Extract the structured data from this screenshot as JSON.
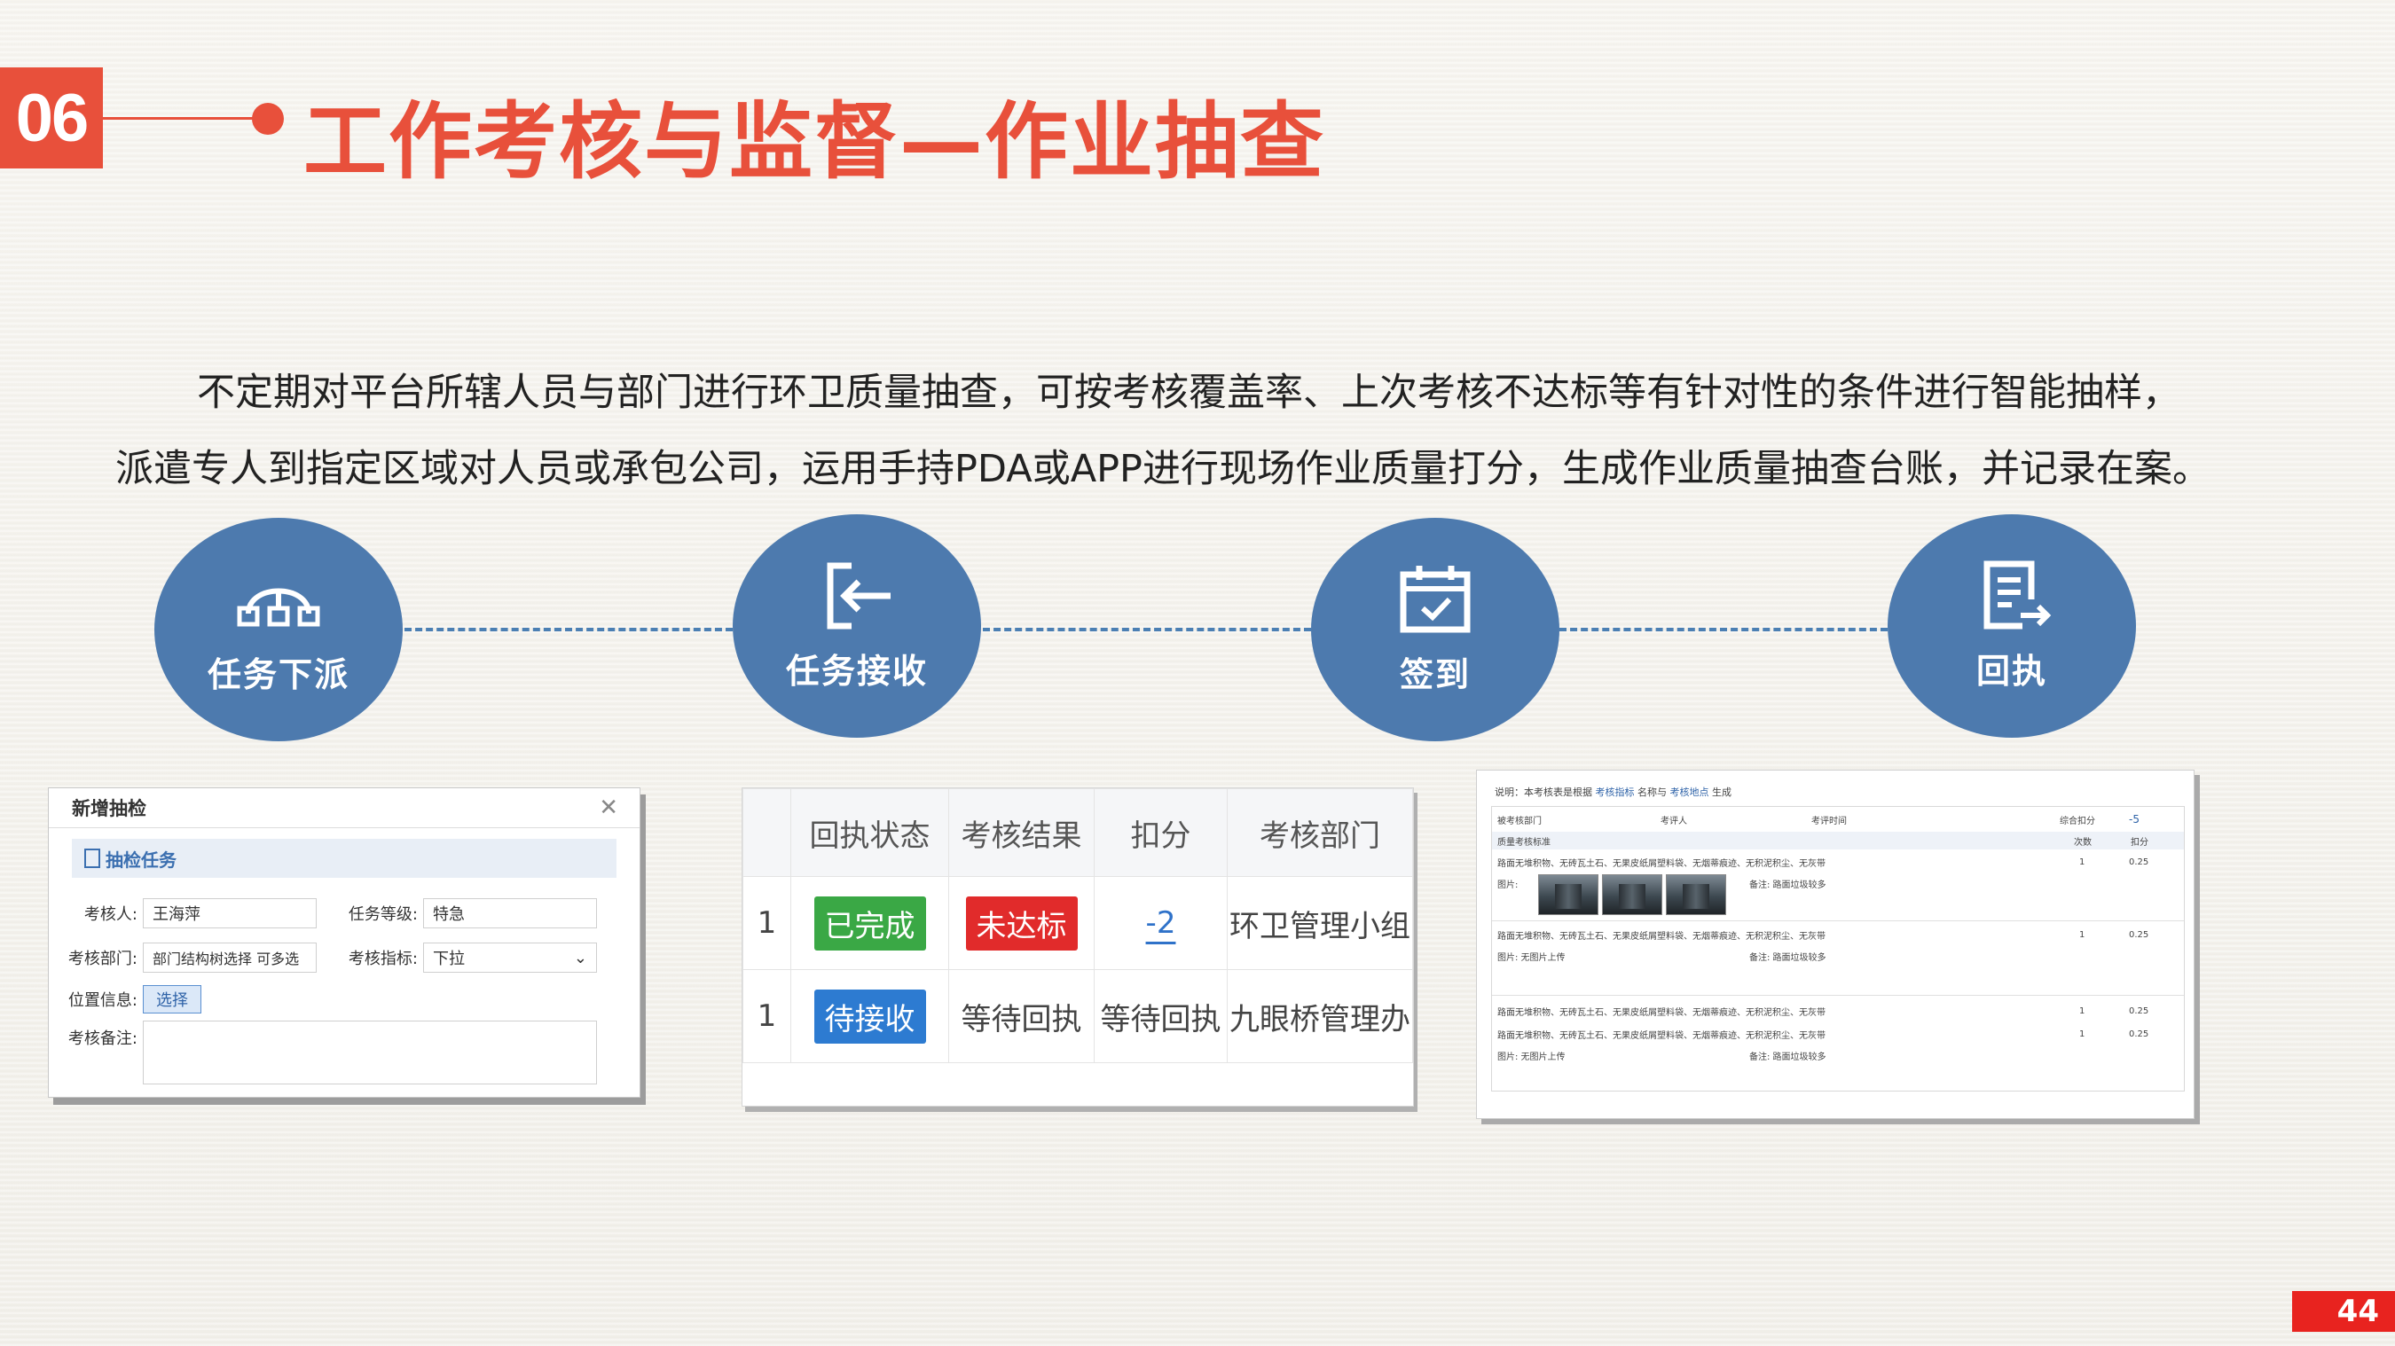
{
  "header": {
    "section_no": "06",
    "title": "工作考核与监督—作业抽查"
  },
  "description": {
    "line1": "不定期对平台所辖人员与部门进行环卫质量抽查，可按考核覆盖率、上次考核不达标等有针对性的条件进行智能抽样，",
    "line2": "派遣专人到指定区域对人员或承包公司，运用手持PDA或APP进行现场作业质量打分，生成作业质量抽查台账，并记录在案。"
  },
  "flow": [
    {
      "label": "任务下派",
      "icon": "hierarchy-icon"
    },
    {
      "label": "任务接收",
      "icon": "sign-in-icon"
    },
    {
      "label": "签到",
      "icon": "calendar-check-icon"
    },
    {
      "label": "回执",
      "icon": "document-export-icon"
    }
  ],
  "form": {
    "title": "新增抽检",
    "section": "抽检任务",
    "assessor_label": "考核人:",
    "assessor_value": "王海萍",
    "level_label": "任务等级:",
    "level_value": "特急",
    "dept_label": "考核部门:",
    "dept_value": "部门结构树选择  可多选",
    "index_label": "考核指标:",
    "index_value": "下拉",
    "location_label": "位置信息:",
    "location_button": "选择",
    "remark_label": "考核备注:"
  },
  "status_table": {
    "headers": [
      "",
      "回执状态",
      "考核结果",
      "扣分",
      "考核部门"
    ],
    "rows": [
      {
        "index": "1",
        "status": "已完成",
        "result": "未达标",
        "deduct": "-2",
        "dept": "环卫管理小组"
      },
      {
        "index": "1",
        "status": "待接收",
        "result": "等待回执",
        "deduct": "等待回执",
        "dept": "九眼桥管理办"
      }
    ]
  },
  "report": {
    "note_prefix": "说明：本考核表是根据",
    "note_index": "考核指标",
    "note_mid": "名称与",
    "note_place": "考核地点",
    "note_suffix": "生成",
    "col_dept": "被考核部门",
    "col_assessor": "考评人",
    "col_time": "考评时间",
    "col_total": "综合扣分",
    "total_value": "-5",
    "std_label": "质量考核标准",
    "col_times": "次数",
    "col_deduct": "扣分",
    "criterion": "路面无堆积物、无砖瓦土石、无果皮纸屑塑料袋、无烟蒂痕迹、无积泥积尘、无灰带",
    "pic_label": "图片:",
    "no_pic": "图片: 无图片上传",
    "remark": "备注: 路面垃圾较多",
    "times": "1",
    "deduct": "0.25"
  },
  "page_number": "44"
}
